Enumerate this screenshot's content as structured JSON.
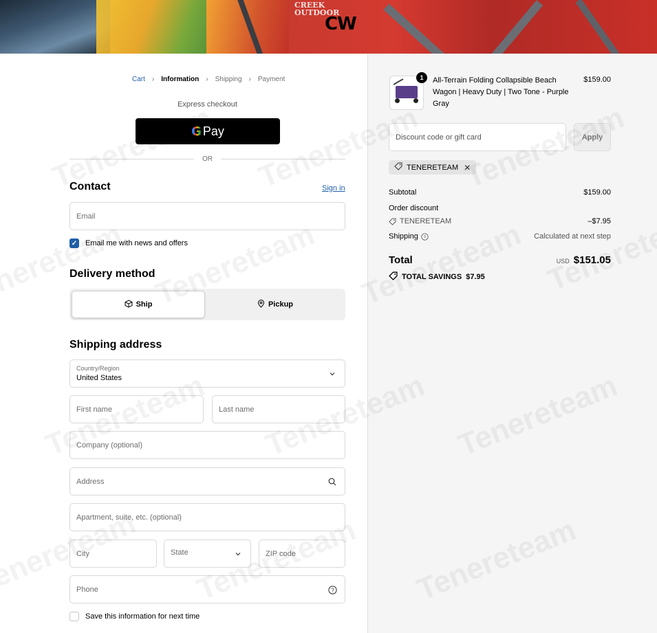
{
  "banner": {
    "brand_text": "CREEK\nOUTDOOR",
    "logo": "CW"
  },
  "breadcrumb": {
    "items": [
      "Cart",
      "Information",
      "Shipping",
      "Payment"
    ]
  },
  "express": {
    "title": "Express checkout",
    "gpay_g": "G",
    "gpay_pay": "Pay",
    "or": "OR"
  },
  "contact": {
    "heading": "Contact",
    "signin": "Sign in",
    "email_placeholder": "Email",
    "news_label": "Email me with news and offers",
    "news_checked": true
  },
  "delivery": {
    "heading": "Delivery method",
    "ship": "Ship",
    "pickup": "Pickup",
    "selected": "Ship"
  },
  "shipping": {
    "heading": "Shipping address",
    "country_label": "Country/Region",
    "country_value": "United States",
    "first_name": "First name",
    "last_name": "Last name",
    "company": "Company (optional)",
    "address": "Address",
    "apartment": "Apartment, suite, etc. (optional)",
    "city": "City",
    "state": "State",
    "zip": "ZIP code",
    "phone": "Phone",
    "save_label": "Save this information for next time",
    "save_checked": false
  },
  "summary": {
    "product": {
      "name": "All-Terrain Folding Collapsible Beach Wagon | Heavy Duty | Two Tone - Purple Gray",
      "price": "$159.00",
      "quantity": "1"
    },
    "discount_placeholder": "Discount code or gift card",
    "apply": "Apply",
    "applied_code": "TENERETEAM",
    "subtotal_label": "Subtotal",
    "subtotal_value": "$159.00",
    "order_discount_label": "Order discount",
    "discount_code": "TENERETEAM",
    "discount_value": "–$7.95",
    "shipping_label": "Shipping",
    "shipping_value": "Calculated at next step",
    "total_label": "Total",
    "total_currency": "USD",
    "total_value": "$151.05",
    "savings_label": "TOTAL SAVINGS",
    "savings_value": "$7.95"
  },
  "watermark": "Tenereteam",
  "colors": {
    "accent": "#1f5fa8",
    "summary_bg": "#f5f5f5",
    "button_dark": "#000000"
  }
}
